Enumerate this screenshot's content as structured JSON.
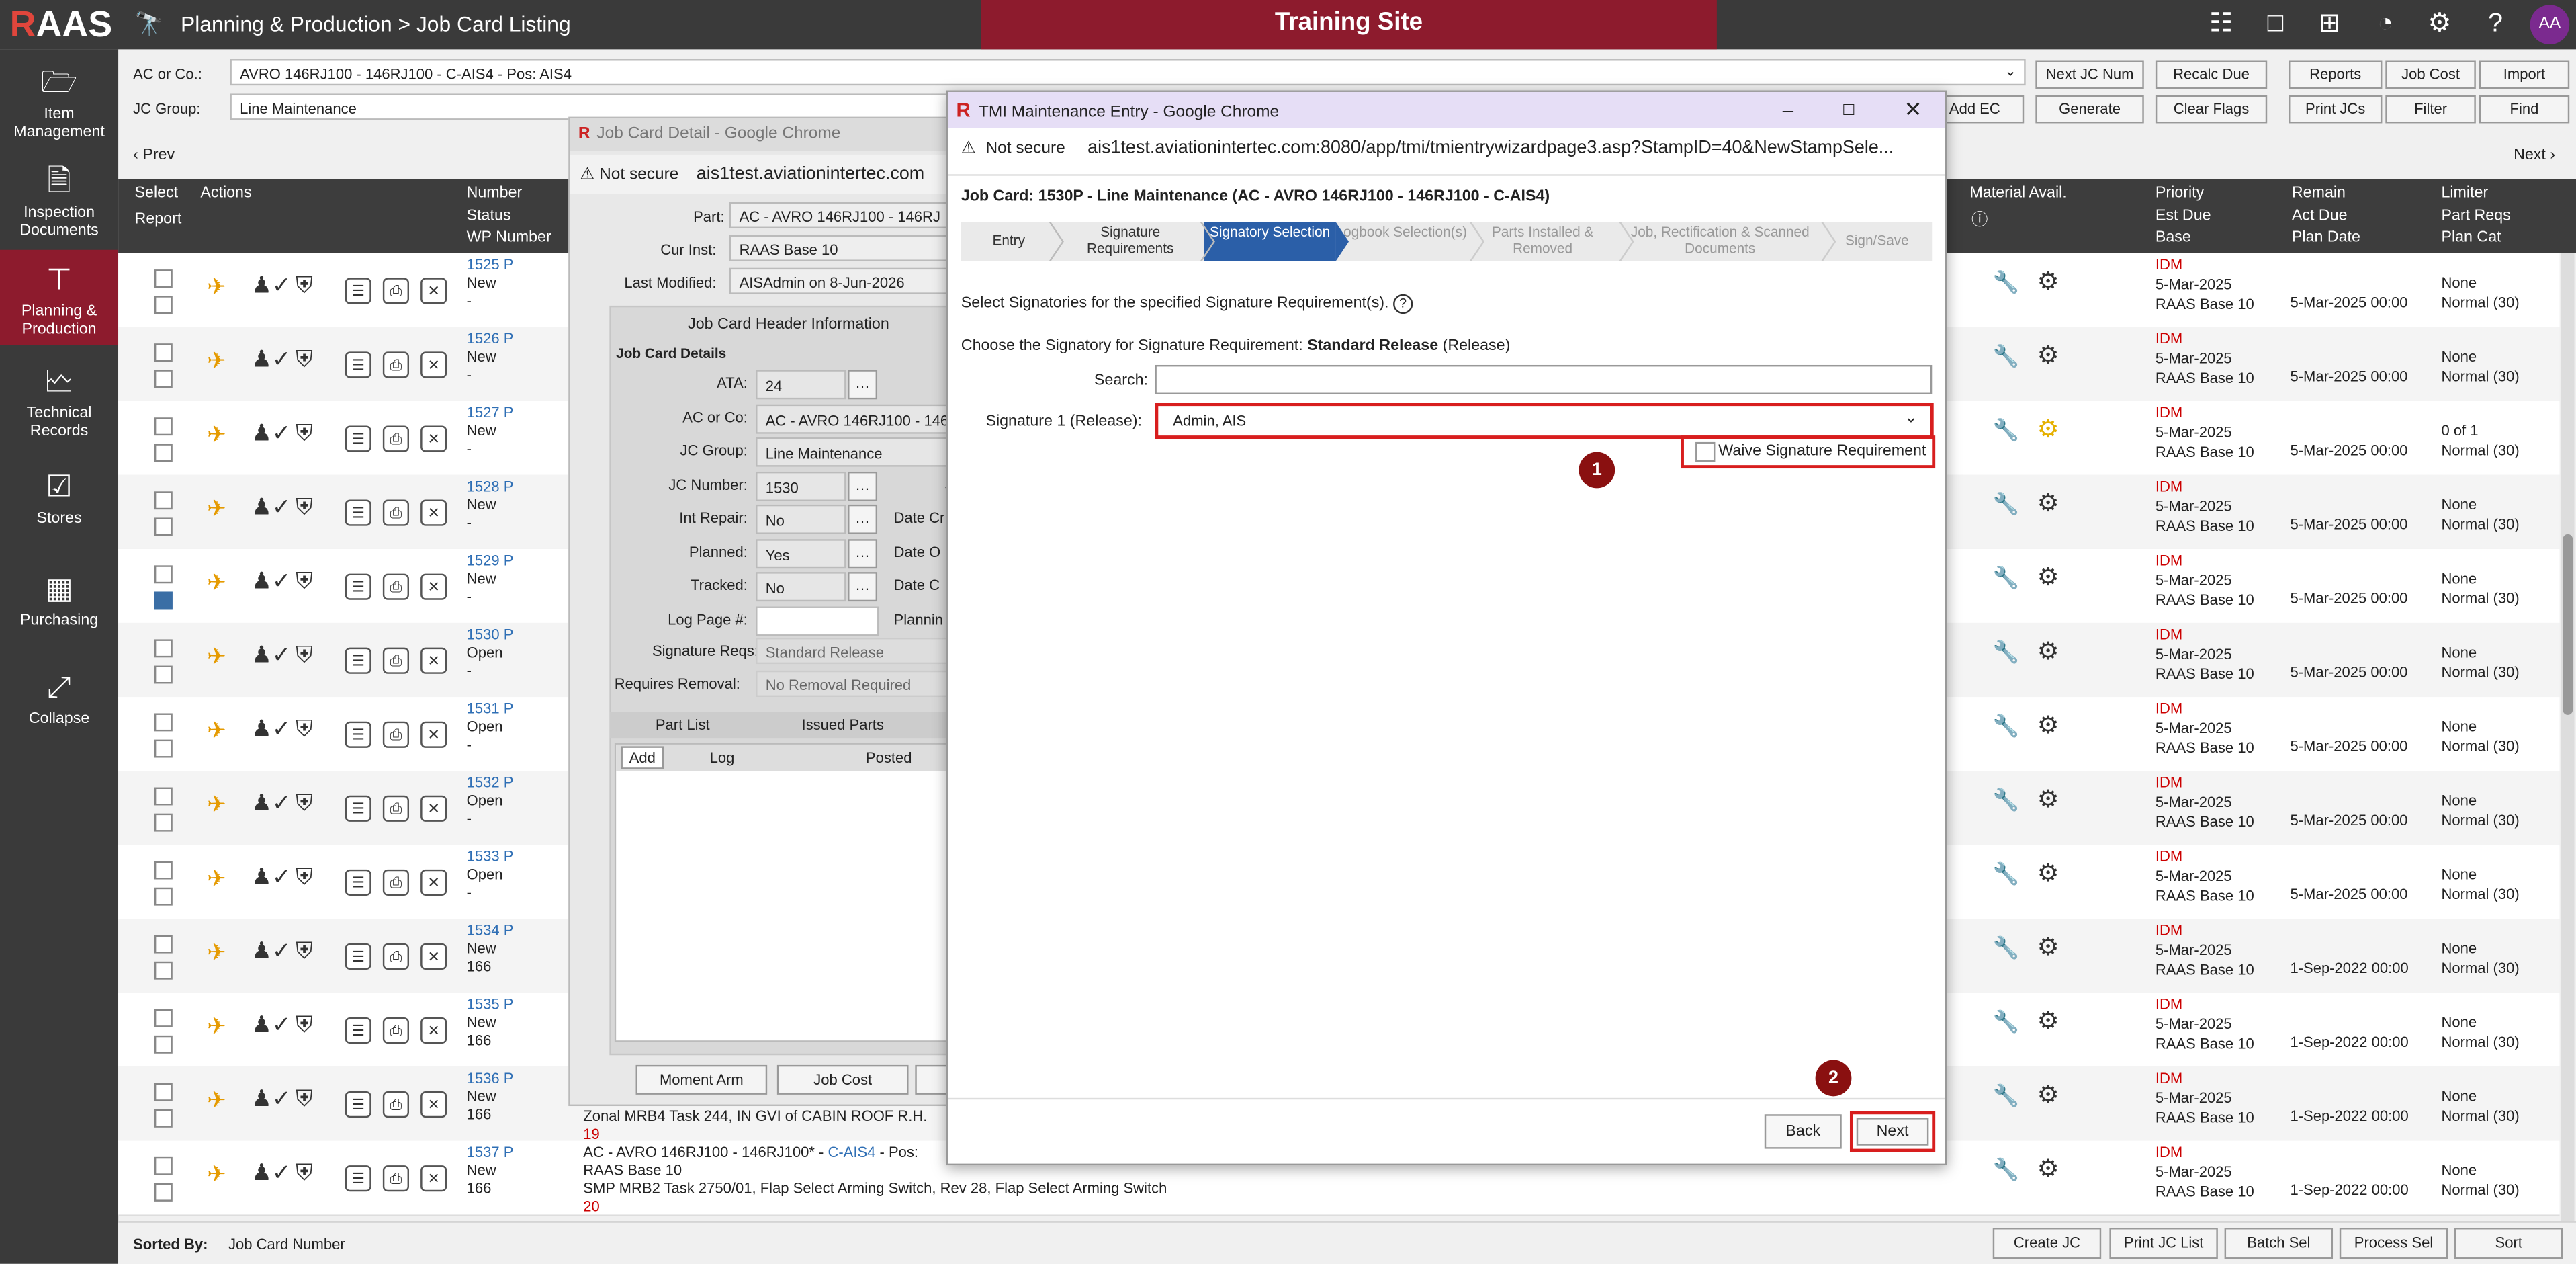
{
  "app": {
    "logo": "RAAS",
    "logo_r": "R",
    "breadcrumb": "Planning & Production > Job Card Listing",
    "training": "Training Site",
    "avatar": "AA"
  },
  "topicons": [
    "person-card-icon",
    "chat-icon",
    "plus-box-icon",
    "pie-icon",
    "gear-icon",
    "help-icon"
  ],
  "sidebar": [
    {
      "label": "Item Management",
      "icon": "folder-icon",
      "glyph": "🗀"
    },
    {
      "label": "Inspection Documents",
      "icon": "document-icon",
      "glyph": "🗎"
    },
    {
      "label": "Planning & Production",
      "icon": "flow-icon",
      "glyph": "⧉"
    },
    {
      "label": "Technical Records",
      "icon": "chart-doc-icon",
      "glyph": "🗠"
    },
    {
      "label": "Stores",
      "icon": "clipboard-icon",
      "glyph": "📋"
    },
    {
      "label": "Purchasing",
      "icon": "calculator-icon",
      "glyph": "▦"
    },
    {
      "label": "Collapse",
      "icon": "collapse-icon",
      "glyph": "⤡"
    }
  ],
  "filters": {
    "ac_label": "AC or Co.:",
    "ac_value": "AVRO 146RJ100 - 146RJ100 - C-AIS4 - Pos: AIS4",
    "jc_group_label": "JC Group:",
    "jc_group_value": "Line Maintenance",
    "buttons_row1": [
      "Next JC Num",
      "Recalc Due",
      "Reports",
      "Job Cost",
      "Import"
    ],
    "buttons_row2": [
      "Add EC",
      "Generate",
      "Clear Flags",
      "Print JCs",
      "Filter",
      "Find"
    ],
    "prev": "Prev",
    "next": "Next"
  },
  "grid": {
    "headers": {
      "select": "Select",
      "report": "Report",
      "actions": "Actions",
      "number": "Number",
      "status": "Status",
      "wp": "WP Number",
      "material": "Material Avail.",
      "priority": "Priority",
      "est_due": "Est Due",
      "base": "Base",
      "remain": "Remain",
      "act_due": "Act Due",
      "plan_date": "Plan Date",
      "limiter": "Limiter",
      "part_reqs": "Part Reqs",
      "plan_cat": "Plan Cat"
    },
    "rows": [
      {
        "num": "1525 P",
        "status": "New",
        "wp": "-",
        "checked": false,
        "prio": "IDM",
        "est": "5-Mar-2025",
        "base": "RAAS Base 10",
        "plan": "5-Mar-2025 00:00",
        "lim1": "None",
        "lim2": "Normal (30)",
        "gear_warn": false
      },
      {
        "num": "1526 P",
        "status": "New",
        "wp": "-",
        "checked": false,
        "prio": "IDM",
        "est": "5-Mar-2025",
        "base": "RAAS Base 10",
        "plan": "5-Mar-2025 00:00",
        "lim1": "None",
        "lim2": "Normal (30)",
        "gear_warn": false
      },
      {
        "num": "1527 P",
        "status": "New",
        "wp": "-",
        "checked": false,
        "prio": "IDM",
        "est": "5-Mar-2025",
        "base": "RAAS Base 10",
        "plan": "5-Mar-2025 00:00",
        "lim1": "0 of 1",
        "lim2": "Normal (30)",
        "gear_warn": true
      },
      {
        "num": "1528 P",
        "status": "New",
        "wp": "-",
        "checked": false,
        "prio": "IDM",
        "est": "5-Mar-2025",
        "base": "RAAS Base 10",
        "plan": "5-Mar-2025 00:00",
        "lim1": "None",
        "lim2": "Normal (30)",
        "gear_warn": false
      },
      {
        "num": "1529 P",
        "status": "New",
        "wp": "-",
        "checked": true,
        "prio": "IDM",
        "est": "5-Mar-2025",
        "base": "RAAS Base 10",
        "plan": "5-Mar-2025 00:00",
        "lim1": "None",
        "lim2": "Normal (30)",
        "gear_warn": false
      },
      {
        "num": "1530 P",
        "status": "Open",
        "wp": "-",
        "checked": false,
        "prio": "IDM",
        "est": "5-Mar-2025",
        "base": "RAAS Base 10",
        "plan": "5-Mar-2025 00:00",
        "lim1": "None",
        "lim2": "Normal (30)",
        "gear_warn": false
      },
      {
        "num": "1531 P",
        "status": "Open",
        "wp": "-",
        "checked": false,
        "prio": "IDM",
        "est": "5-Mar-2025",
        "base": "RAAS Base 10",
        "plan": "5-Mar-2025 00:00",
        "lim1": "None",
        "lim2": "Normal (30)",
        "gear_warn": false
      },
      {
        "num": "1532 P",
        "status": "Open",
        "wp": "-",
        "checked": false,
        "prio": "IDM",
        "est": "5-Mar-2025",
        "base": "RAAS Base 10",
        "plan": "5-Mar-2025 00:00",
        "lim1": "None",
        "lim2": "Normal (30)",
        "gear_warn": false
      },
      {
        "num": "1533 P",
        "status": "Open",
        "wp": "-",
        "checked": false,
        "prio": "IDM",
        "est": "5-Mar-2025",
        "base": "RAAS Base 10",
        "plan": "5-Mar-2025 00:00",
        "lim1": "None",
        "lim2": "Normal (30)",
        "gear_warn": false
      },
      {
        "num": "1534 P",
        "status": "New",
        "wp": "166",
        "checked": false,
        "prio": "IDM",
        "est": "5-Mar-2025",
        "base": "RAAS Base 10",
        "plan": "1-Sep-2022 00:00",
        "lim1": "None",
        "lim2": "Normal (30)",
        "gear_warn": false
      },
      {
        "num": "1535 P",
        "status": "New",
        "wp": "166",
        "checked": false,
        "prio": "IDM",
        "est": "5-Mar-2025",
        "base": "RAAS Base 10",
        "plan": "1-Sep-2022 00:00",
        "lim1": "None",
        "lim2": "Normal (30)",
        "gear_warn": false
      },
      {
        "num": "1536 P",
        "status": "New",
        "wp": "166",
        "checked": false,
        "prio": "IDM",
        "est": "5-Mar-2025",
        "base": "RAAS Base 10",
        "plan": "1-Sep-2022 00:00",
        "lim1": "None",
        "lim2": "Normal (30)",
        "gear_warn": false
      },
      {
        "num": "1537 P",
        "status": "New",
        "wp": "166",
        "checked": false,
        "prio": "IDM",
        "est": "5-Mar-2025",
        "base": "RAAS Base 10",
        "plan": "1-Sep-2022 00:00",
        "lim1": "None",
        "lim2": "Normal (30)",
        "gear_warn": false
      }
    ],
    "desc_1536": "Zonal MRB4 Task 244, IN GVI of CABIN ROOF R.H.",
    "desc_1536_num": "19",
    "desc_1537_line1a": "AC - AVRO 146RJ100 - 146RJ100* - ",
    "desc_1537_line1b": "C-AIS4",
    "desc_1537_line1c": " - Pos:",
    "desc_1537_line2": "RAAS Base 10",
    "desc_1537_line3": "SMP MRB2 Task 2750/01, Flap Select Arming Switch, Rev 28, Flap Select Arming Switch",
    "desc_1537_num": "20"
  },
  "bottom": {
    "sorted_label": "Sorted By:",
    "sorted_value": "Job Card Number",
    "buttons": [
      "Create JC",
      "Print JC List",
      "Batch Sel",
      "Process Sel",
      "Sort"
    ]
  },
  "jcd": {
    "title": "Job Card Detail - Google Chrome",
    "not_secure": "Not secure",
    "url": "ais1test.aviationintertec.com",
    "part_label": "Part:",
    "part_value": "AC - AVRO 146RJ100 - 146RJ",
    "curinst_label": "Cur Inst:",
    "curinst_value": "RAAS Base 10",
    "lastmod_label": "Last Modified:",
    "lastmod_value": "AISAdmin on 8-Jun-2026",
    "header_title": "Job Card Header Information",
    "details_label": "Job Card Details",
    "fields": [
      {
        "label": "ATA:",
        "value": "24"
      },
      {
        "label": "AC or Co:",
        "value": "AC - AVRO 146RJ100 - 146"
      },
      {
        "label": "JC Group:",
        "value": "Line Maintenance"
      },
      {
        "label": "JC Number:",
        "value": "1530"
      },
      {
        "label": "Int Repair:",
        "value": "No"
      },
      {
        "label": "Planned:",
        "value": "Yes"
      },
      {
        "label": "Tracked:",
        "value": "No"
      },
      {
        "label": "Log Page #:",
        "value": ""
      }
    ],
    "right_labels": [
      "S",
      "Date Cr",
      "Date O",
      "Date C",
      "Plannin"
    ],
    "sigreqs_label": "Signature Reqs:",
    "sigreqs_value": "Standard Release",
    "reqremoval_label": "Requires Removal:",
    "reqremoval_value": "No Removal Required",
    "tab_partlist": "Part List",
    "tab_issued": "Issued Parts",
    "add": "Add",
    "log": "Log",
    "posted": "Posted",
    "btn_moment": "Moment Arm",
    "btn_jobcost": "Job Cost"
  },
  "tmi": {
    "title": "TMI Maintenance Entry - Google Chrome",
    "not_secure": "Not secure",
    "url": "ais1test.aviationintertec.com:8080/app/tmi/tmientrywizardpage3.asp?StampID=40&NewStampSele...",
    "job_card": "Job Card: 1530P - Line Maintenance  (AC - AVRO 146RJ100 - 146RJ100 - C-AIS4)",
    "steps": [
      "Entry",
      "Signature Requirements",
      "Signatory Selection",
      "Logbook Selection(s)",
      "Parts Installed & Removed",
      "Job, Rectification & Scanned Documents",
      "Sign/Save"
    ],
    "instruction": "Select Signatories for the specified Signature Requirement(s).",
    "choose_prefix": "Choose the Signatory for Signature Requirement: ",
    "choose_bold": "Standard Release",
    "choose_suffix": " (Release)",
    "search_label": "Search:",
    "search_value": "",
    "sig_label": "Signature 1 (Release):",
    "sig_value": "Admin, AIS",
    "waive_label": "Waive Signature Requirement",
    "marker1": "1",
    "marker2": "2",
    "back": "Back",
    "next": "Next"
  }
}
